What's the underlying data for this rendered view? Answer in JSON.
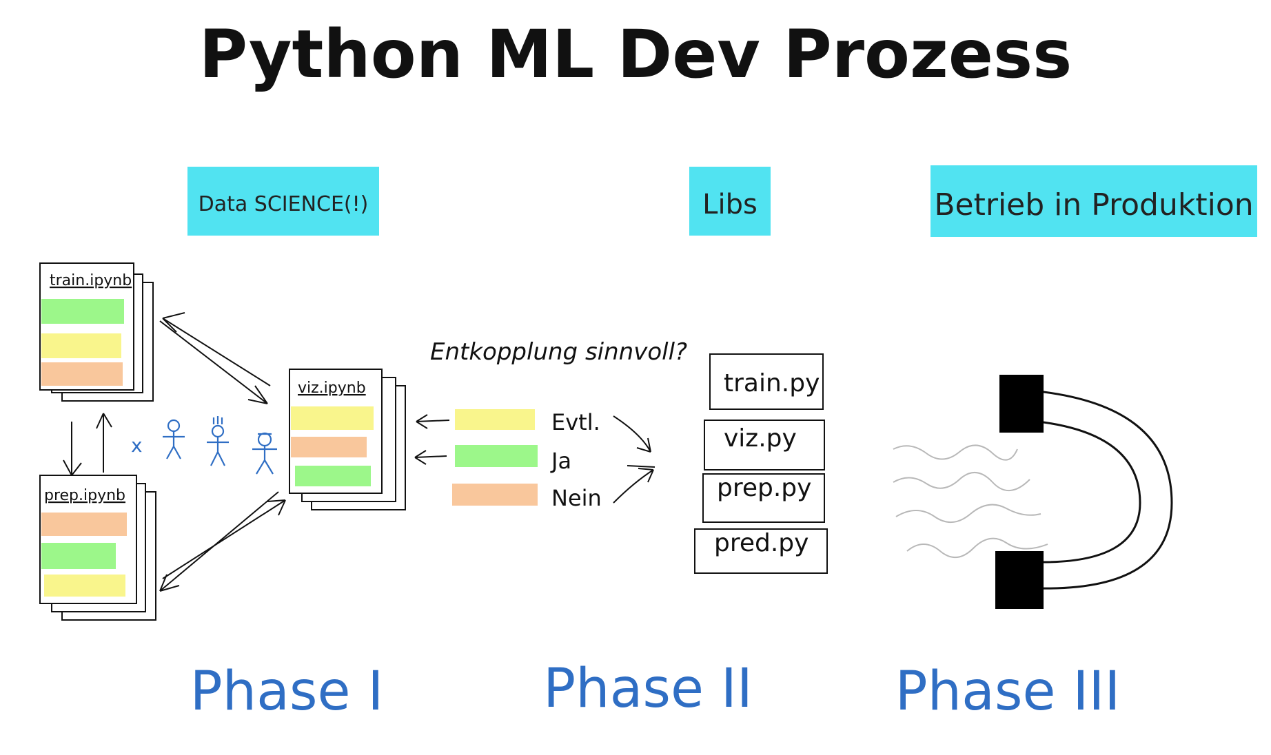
{
  "title": "Python ML Dev Prozess",
  "headers": {
    "data_science": "Data SCIENCE(!)",
    "libs": "Libs",
    "production": "Betrieb in Produktion"
  },
  "notebooks": {
    "train": "train.ipynb",
    "prep": "prep.ipynb",
    "viz": "viz.ipynb"
  },
  "question": "Entkopplung sinnvoll?",
  "legend": {
    "eventually": "Evtl.",
    "yes": "Ja",
    "no": "Nein"
  },
  "people_marks": "x",
  "libs": {
    "train": "train.py",
    "viz": "viz.py",
    "prep": "prep.py",
    "pred": "pred.py"
  },
  "phases": {
    "one": "Phase I",
    "two": "Phase II",
    "three": "Phase III"
  },
  "colors": {
    "highlight": "#3ee0ef",
    "green": "#9cf78a",
    "yellow": "#f9f58c",
    "orange": "#f9c79c",
    "phase_blue": "#2f6ec4",
    "ink": "#111111",
    "magnet": "#000000",
    "waves": "#b8b8b8"
  }
}
